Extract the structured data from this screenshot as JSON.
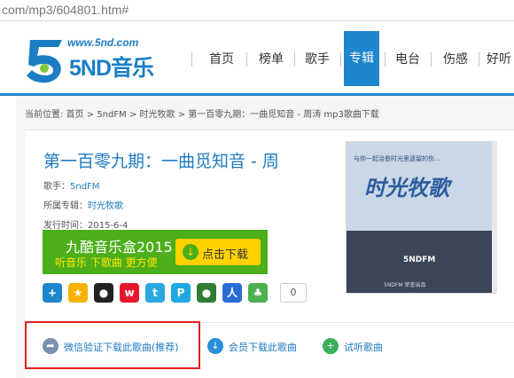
{
  "address_bar": {
    "url": "com/mp3/604801.htm#"
  },
  "header": {
    "logo_url": "www.5nd.com",
    "logo_brand": "5ND音乐",
    "nav": [
      "首页",
      "榜单",
      "歌手",
      "专辑",
      "电台",
      "伤感",
      "好听"
    ],
    "active_nav": "专辑"
  },
  "breadcrumb": {
    "prefix": "当前位置:",
    "items": [
      "首页",
      "5ndFM",
      "时光牧歌",
      "第一百零九期：一曲觅知音 - 周涛 mp3歌曲下载"
    ]
  },
  "song": {
    "title": "第一百零九期：一曲觅知音 - 周",
    "singer_label": "歌手：",
    "singer": "5ndFM",
    "album_label": "所属专辑：",
    "album": "时光牧歌",
    "release_label": "发行时间：",
    "release_date": "2015-6-4"
  },
  "ad": {
    "title": "九酷音乐盒2015",
    "subtitle": "听音乐 下歌曲 更方便",
    "button": "点击下载"
  },
  "share": {
    "icons": [
      "plus-icon",
      "qzone-icon",
      "qq-icon",
      "weibo-icon",
      "tencent-weibo-icon",
      "baidu-icon",
      "douban-icon",
      "renren-icon",
      "kaixin-icon"
    ],
    "count": "0"
  },
  "cover": {
    "caption": "与你一起治愈时光里遗留的伤...",
    "title": "时光牧歌",
    "fm": "5NDFM",
    "footer": "5NDFM 荣誉出品"
  },
  "actions": [
    {
      "label": "微信验证下载此歌曲(推荐)",
      "color": "#7a8fb0",
      "icon": "share-arrow-icon"
    },
    {
      "label": "会员下载此歌曲",
      "color": "#2a8fd8",
      "icon": "download-icon"
    },
    {
      "label": "试听歌曲",
      "color": "#3cae5a",
      "icon": "plus-icon"
    }
  ]
}
